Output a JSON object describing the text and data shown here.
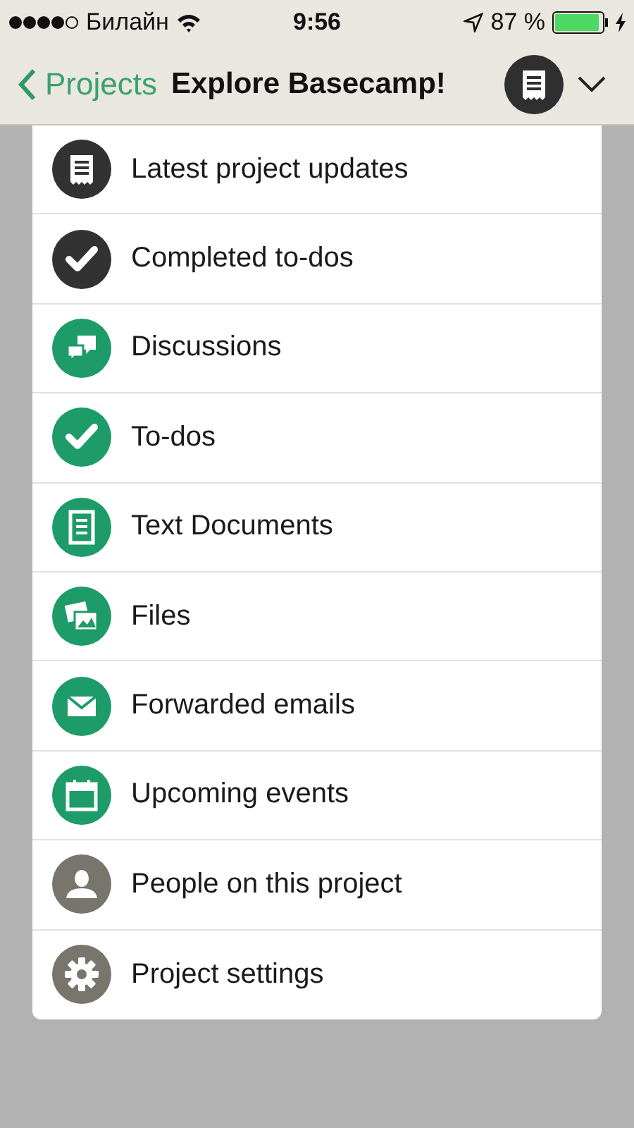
{
  "status_bar": {
    "carrier": "Билайн",
    "time": "9:56",
    "battery": "87 %"
  },
  "nav": {
    "back": "Projects",
    "title": "Explore Basecamp!"
  },
  "menu": [
    {
      "label": "Latest project updates",
      "kind": "updates",
      "color": "#323232"
    },
    {
      "label": "Completed to-dos",
      "kind": "check",
      "color": "#323232"
    },
    {
      "label": "Discussions",
      "kind": "discussion",
      "color": "#1d9b68"
    },
    {
      "label": "To-dos",
      "kind": "check",
      "color": "#1d9b68"
    },
    {
      "label": "Text Documents",
      "kind": "document",
      "color": "#1d9b68"
    },
    {
      "label": "Files",
      "kind": "files",
      "color": "#1d9b68"
    },
    {
      "label": "Forwarded emails",
      "kind": "email",
      "color": "#1d9b68"
    },
    {
      "label": "Upcoming events",
      "kind": "calendar",
      "color": "#1d9b68"
    },
    {
      "label": "People on this project",
      "kind": "person",
      "color": "#77756c"
    },
    {
      "label": "Project settings",
      "kind": "gear",
      "color": "#77756c"
    }
  ]
}
